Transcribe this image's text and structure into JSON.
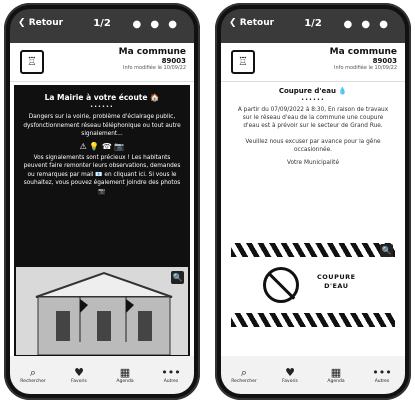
{
  "left_phone": {
    "topbar": {
      "back_label": "Retour",
      "page": "1/2",
      "icons": "● ● ●"
    },
    "header": {
      "commune_name": "Ma commune",
      "postal": "89003",
      "info": "Info modifiée le 10/09/22"
    },
    "title": "La Mairie à votre écoute 🏠",
    "stars": "••••••",
    "paragraph1": "Dangers sur la voirie, problème d'éclairage public, dysfonctionnement réseau téléphonique ou tout autre signalement...",
    "icons_line": "⚠ 💡 ☎ 📷",
    "paragraph2": "Vos signalements sont précieux ! Les habitants peuvent faire remonter leurs observations, demandes ou remarques par mail 📧 en cliquant ici. Si vous le souhaitez, vous pouvez également joindre des photos 📷",
    "zoom_icon_label": "🔍",
    "fab_icon": "⤢",
    "nav": [
      {
        "icon": "⌕",
        "label": "Rechercher"
      },
      {
        "icon": "♥",
        "label": "Favoris"
      },
      {
        "icon": "▦",
        "label": "Agenda"
      },
      {
        "icon": "•••",
        "label": "Autres"
      }
    ]
  },
  "right_phone": {
    "topbar": {
      "back_label": "Retour",
      "page": "1/2",
      "icons": "● ● ●"
    },
    "header": {
      "commune_name": "Ma commune",
      "postal": "89003",
      "info": "Info modifiée le 10/09/22"
    },
    "title": "Coupure d'eau 💧",
    "stars": "••••••",
    "paragraph1": "A partir du 07/09/2022 à 8:30, En raison de travaux sur le réseau d'eau de la commune une coupure d'eau est à prévoir sur le secteur de Grand Rue.",
    "paragraph2": "Veuillez nous excuser par avance pour la gêne occasionnée.",
    "signature": "Votre Municipalité",
    "sign_text_line1": "COUPURE",
    "sign_text_line2": "D'EAU",
    "zoom_icon_label": "🔍",
    "nav": [
      {
        "icon": "⌕",
        "label": "Rechercher"
      },
      {
        "icon": "♥",
        "label": "Favoris"
      },
      {
        "icon": "▦",
        "label": "Agenda"
      },
      {
        "icon": "•••",
        "label": "Autres"
      }
    ]
  }
}
